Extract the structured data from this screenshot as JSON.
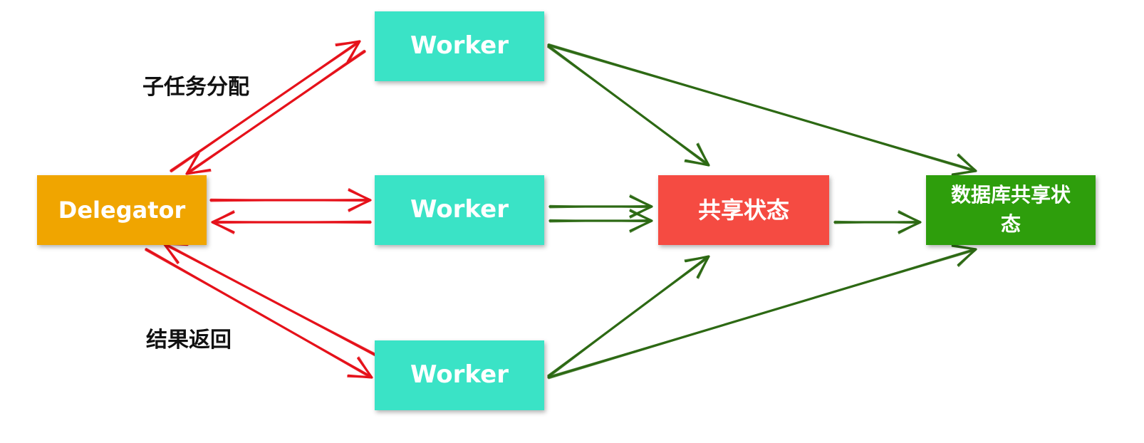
{
  "colors": {
    "delegator": "#F0A500",
    "worker": "#3AE3C6",
    "shared_state": "#F54B42",
    "db_shared_state": "#2E9E0C",
    "task_arrow": "#E5121B",
    "state_arrow": "#2D6A14"
  },
  "nodes": {
    "delegator": {
      "label": "Delegator"
    },
    "worker_top": {
      "label": "Worker"
    },
    "worker_mid": {
      "label": "Worker"
    },
    "worker_bottom": {
      "label": "Worker"
    },
    "shared_state": {
      "label": "共享状态"
    },
    "db_shared_state": {
      "label": "数据库共享状态"
    }
  },
  "annotations": {
    "assign": "子任务分配",
    "return": "结果返回"
  },
  "edges": [
    {
      "from": "delegator",
      "to": "worker_top",
      "kind": "task",
      "bidirectional": true
    },
    {
      "from": "delegator",
      "to": "worker_mid",
      "kind": "task",
      "bidirectional": true
    },
    {
      "from": "delegator",
      "to": "worker_bottom",
      "kind": "task",
      "bidirectional": true
    },
    {
      "from": "worker_top",
      "to": "shared_state",
      "kind": "state"
    },
    {
      "from": "worker_top",
      "to": "db_shared_state",
      "kind": "state"
    },
    {
      "from": "worker_mid",
      "to": "shared_state",
      "kind": "state"
    },
    {
      "from": "worker_bottom",
      "to": "shared_state",
      "kind": "state"
    },
    {
      "from": "worker_bottom",
      "to": "db_shared_state",
      "kind": "state"
    },
    {
      "from": "shared_state",
      "to": "db_shared_state",
      "kind": "state"
    }
  ]
}
